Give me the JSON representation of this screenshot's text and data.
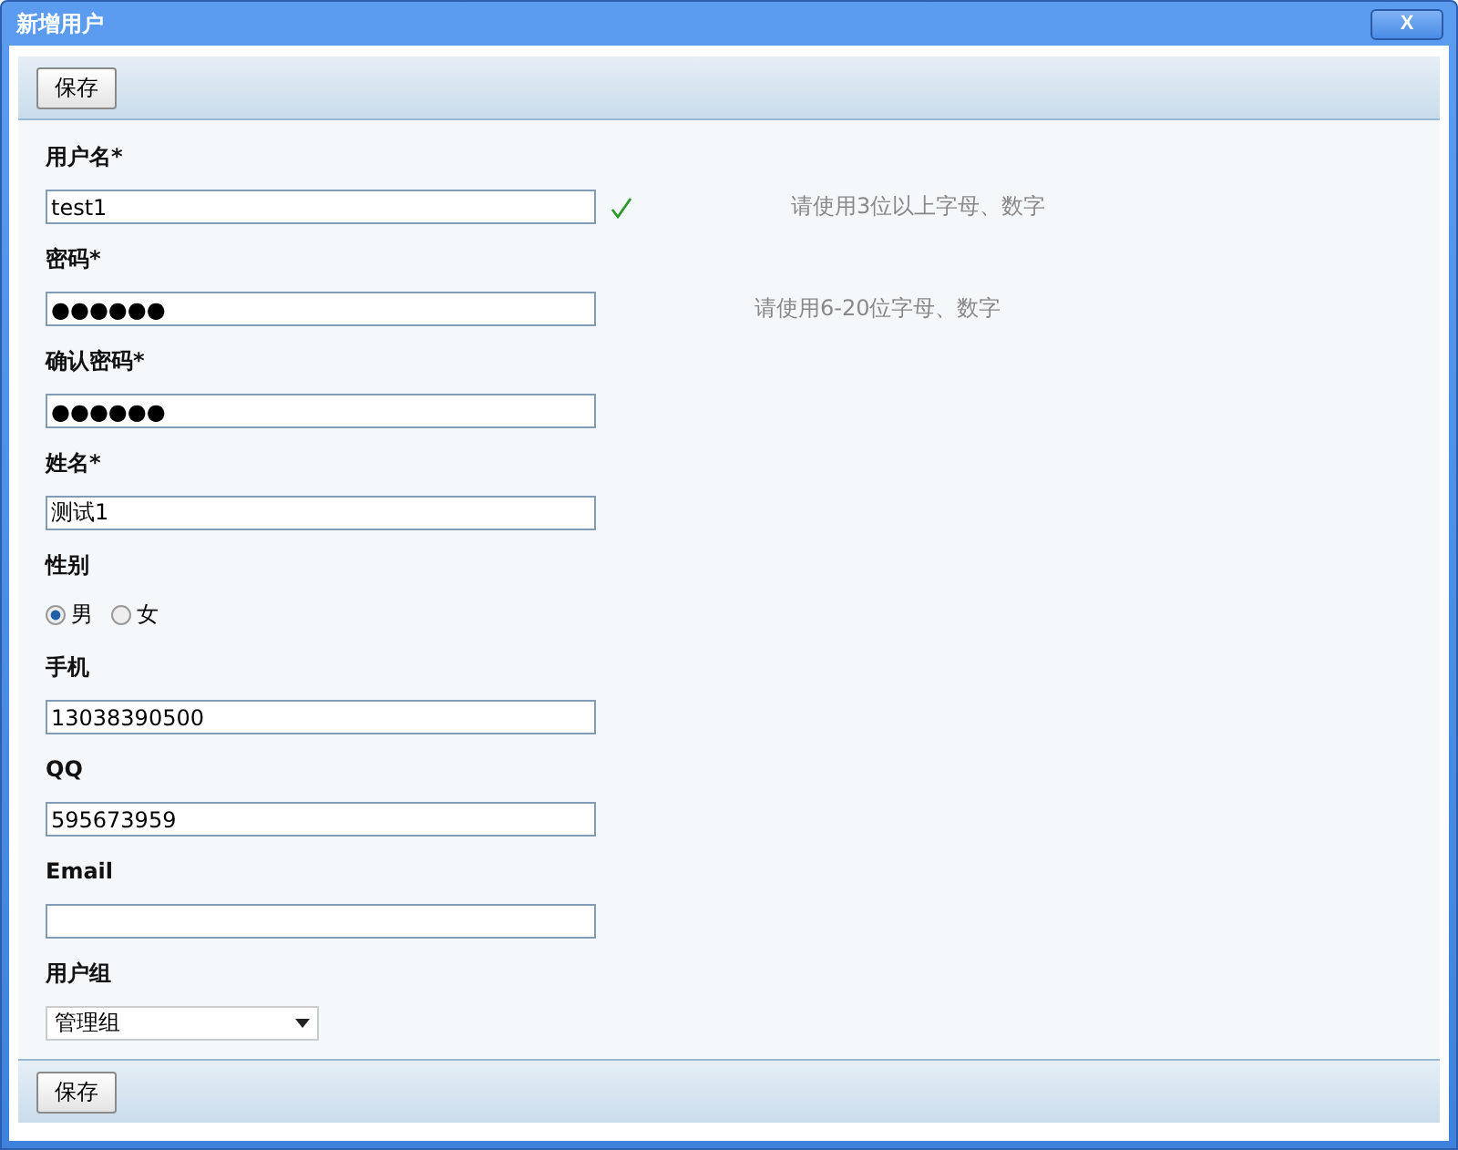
{
  "window": {
    "title": "新增用户",
    "close_label": "X"
  },
  "top_toolbar": {
    "buttons": [
      "保存"
    ]
  },
  "fields": [
    {
      "kind": "text",
      "label": "用户名*",
      "value": "test1",
      "valid": true,
      "hint": "请使用3位以上字母、数字"
    },
    {
      "kind": "text",
      "label": "密码*",
      "value": "●●●●●●",
      "hint": "请使用6-20位字母、数字"
    },
    {
      "kind": "text",
      "label": "确认密码*",
      "value": "●●●●●●"
    },
    {
      "kind": "text",
      "label": "姓名*",
      "value": "测试1"
    },
    {
      "kind": "radio",
      "label": "性别",
      "options": [
        {
          "label": "男",
          "selected": true
        },
        {
          "label": "女",
          "selected": false
        }
      ]
    },
    {
      "kind": "text",
      "label": "手机",
      "value": "13038390500"
    },
    {
      "kind": "text",
      "label": "QQ",
      "value": "595673959"
    },
    {
      "kind": "text",
      "label": "Email"
    },
    {
      "kind": "select",
      "label": "用户组",
      "value": "管理组"
    }
  ],
  "bottom_toolbar": {
    "buttons": [
      "保存"
    ]
  }
}
